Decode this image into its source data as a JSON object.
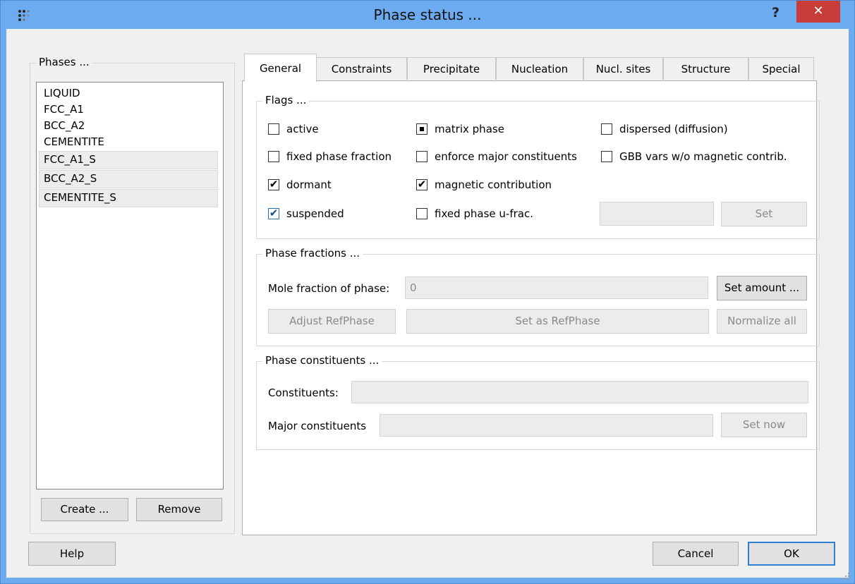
{
  "window": {
    "title": "Phase status ...",
    "help_glyph": "?",
    "close_glyph": "✕"
  },
  "phases": {
    "group_title": "Phases ...",
    "items": [
      "LIQUID",
      "FCC_A1",
      "BCC_A2",
      "CEMENTITE",
      "FCC_A1_S",
      "BCC_A2_S",
      "CEMENTITE_S"
    ],
    "create_label": "Create ...",
    "remove_label": "Remove"
  },
  "tabs": [
    "General",
    "Constraints",
    "Precipitate",
    "Nucleation",
    "Nucl. sites",
    "Structure",
    "Special"
  ],
  "flags": {
    "title": "Flags ...",
    "active": "active",
    "fixed_phase_fraction": "fixed phase fraction",
    "dormant": "dormant",
    "suspended": "suspended",
    "matrix_phase": "matrix phase",
    "enforce_major_constituents": "enforce major constituents",
    "magnetic_contribution": "magnetic contribution",
    "fixed_phase_u_frac": "fixed phase u-frac.",
    "dispersed": "dispersed (diffusion)",
    "gbb_vars": "GBB vars w/o magnetic contrib.",
    "set_label": "Set"
  },
  "phase_fractions": {
    "title": "Phase fractions ...",
    "mole_fraction_label": "Mole fraction of phase:",
    "mole_fraction_value": "0",
    "set_amount_label": "Set amount ...",
    "adjust_refphase_label": "Adjust RefPhase",
    "set_as_refphase_label": "Set as RefPhase",
    "normalize_all_label": "Normalize all"
  },
  "phase_constituents": {
    "title": "Phase constituents ...",
    "constituents_label": "Constituents:",
    "major_constituents_label": "Major constituents",
    "set_now_label": "Set now"
  },
  "footer": {
    "help_label": "Help",
    "cancel_label": "Cancel",
    "ok_label": "OK"
  },
  "colors": {
    "titlebar": "#6cabf0",
    "close": "#c93c37",
    "accent": "#2f7fd6"
  }
}
